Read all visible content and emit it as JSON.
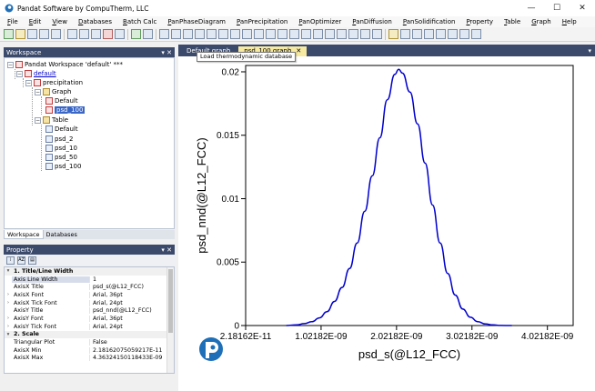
{
  "window": {
    "title": "Pandat Software by CompuTherm, LLC",
    "controls": [
      "—",
      "☐",
      "✕"
    ]
  },
  "menu": [
    {
      "u": "F",
      "rest": "ile"
    },
    {
      "u": "E",
      "rest": "dit"
    },
    {
      "u": "V",
      "rest": "iew"
    },
    {
      "u": "D",
      "rest": "atabases"
    },
    {
      "u": "B",
      "rest": "atch Calc"
    },
    {
      "u": "P",
      "rest": "anPhaseDiagram"
    },
    {
      "u": "P",
      "rest": "anPrecipitation"
    },
    {
      "u": "P",
      "rest": "anOptimizer"
    },
    {
      "u": "P",
      "rest": "anDiffusion"
    },
    {
      "u": "P",
      "rest": "anSolidification"
    },
    {
      "u": "P",
      "rest": "roperty"
    },
    {
      "u": "T",
      "rest": "able"
    },
    {
      "u": "G",
      "rest": "raph"
    },
    {
      "u": "H",
      "rest": "elp"
    }
  ],
  "workspace": {
    "header": "Workspace",
    "header_buttons": "▾ ✕",
    "tree": {
      "root": "Pandat Workspace 'default' ***",
      "project": "default",
      "module": "precipitation",
      "graph_folder": "Graph",
      "graph_items": [
        "Default",
        "psd_100"
      ],
      "table_folder": "Table",
      "table_items": [
        "Default",
        "psd_2",
        "psd_10",
        "psd_50",
        "psd_100"
      ]
    },
    "tabs": [
      "Workspace",
      "Databases"
    ]
  },
  "property": {
    "header": "Property",
    "header_buttons": "▾ ✕",
    "toolbar": [
      "⁞",
      "AZ",
      "▤"
    ],
    "rows": [
      {
        "kind": "cat",
        "gutter": "▾",
        "name": "1. Title/Line Width"
      },
      {
        "kind": "row",
        "gutter": "",
        "name": "Axis Line Width",
        "value": "1",
        "hl": true
      },
      {
        "kind": "row",
        "gutter": "",
        "name": "AxisX Title",
        "value": "psd_s(@L12_FCC)"
      },
      {
        "kind": "row",
        "gutter": "›",
        "name": "AxisX Font",
        "value": "Arial, 36pt"
      },
      {
        "kind": "row",
        "gutter": "›",
        "name": "AxisX Tick Font",
        "value": "Arial, 24pt"
      },
      {
        "kind": "row",
        "gutter": "",
        "name": "AxisY Title",
        "value": "psd_nnd(@L12_FCC)"
      },
      {
        "kind": "row",
        "gutter": "›",
        "name": "AxisY Font",
        "value": "Arial, 36pt"
      },
      {
        "kind": "row",
        "gutter": "›",
        "name": "AxisY Tick Font",
        "value": "Arial, 24pt"
      },
      {
        "kind": "cat",
        "gutter": "▾",
        "name": "2. Scale"
      },
      {
        "kind": "row",
        "gutter": "",
        "name": "Triangular Plot",
        "value": "False"
      },
      {
        "kind": "row",
        "gutter": "",
        "name": "AxisX Min",
        "value": "2.18162075059217E-11"
      },
      {
        "kind": "row",
        "gutter": "",
        "name": "AxisX Max",
        "value": "4.36324150118433E-09"
      }
    ]
  },
  "documents": {
    "tabs": [
      {
        "label": "Default graph",
        "active": false
      },
      {
        "label": "psd_100 graph",
        "active": true,
        "close": "✕"
      }
    ],
    "menu_arrow": "▾",
    "tooltip": "Load thermodynamic database"
  },
  "colors": {
    "accent": "#3b4a6b",
    "curve": "#0000cc",
    "active_tab": "#f6e9a2",
    "logo": "#1e6fb8"
  },
  "chart_data": {
    "type": "line",
    "xlabel": "psd_s(@L12_FCC)",
    "ylabel": "psd_nnd(@L12_FCC)",
    "xlim": [
      2.18162e-11,
      4.36324e-09
    ],
    "ylim": [
      0,
      0.0205
    ],
    "xticks": [
      2.18162e-11,
      1.02182e-09,
      2.02182e-09,
      3.02182e-09,
      4.02182e-09
    ],
    "xtick_labels": [
      "2.18162E-11",
      "1.02182E-09",
      "2.02182E-09",
      "3.02182E-09",
      "4.02182E-09"
    ],
    "yticks": [
      0,
      0.005,
      0.01,
      0.015,
      0.02
    ],
    "ytick_labels": [
      "0",
      "0.005",
      "0.01",
      "0.015",
      "0.02"
    ],
    "grid": false,
    "series": [
      {
        "x": [
          5.6e-10,
          7e-10,
          8e-10,
          9e-10,
          1e-09,
          1.1e-09,
          1.2e-09,
          1.3e-09,
          1.4e-09,
          1.5e-09,
          1.6e-09,
          1.7e-09,
          1.8e-09,
          1.9e-09,
          2e-09,
          2.05e-09,
          2.1e-09,
          2.2e-09,
          2.3e-09,
          2.4e-09,
          2.5e-09,
          2.6e-09,
          2.7e-09,
          2.8e-09,
          2.9e-09,
          3e-09,
          3.1e-09,
          3.2e-09,
          3.3e-09,
          3.4e-09,
          3.55e-09
        ],
        "y": [
          0,
          5e-05,
          0.00015,
          0.0003,
          0.0006,
          0.0011,
          0.0019,
          0.003,
          0.0045,
          0.0065,
          0.009,
          0.0118,
          0.0148,
          0.0178,
          0.0198,
          0.0202,
          0.0199,
          0.0184,
          0.0159,
          0.0128,
          0.0095,
          0.0065,
          0.0041,
          0.0024,
          0.0013,
          0.00065,
          0.0003,
          0.00012,
          5e-05,
          1e-05,
          0
        ]
      }
    ]
  }
}
